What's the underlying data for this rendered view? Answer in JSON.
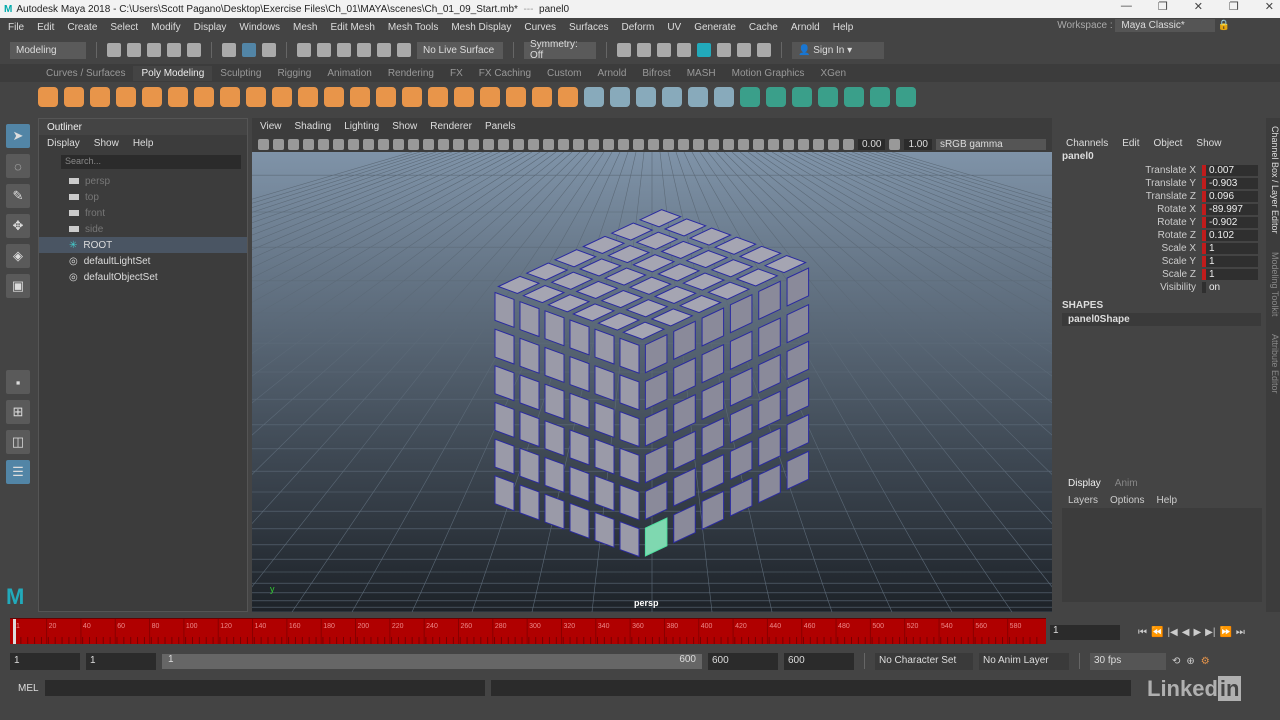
{
  "title": {
    "app": "Autodesk Maya 2018",
    "path": "C:\\Users\\Scott Pagano\\Desktop\\Exercise Files\\Ch_01\\MAYA\\scenes\\Ch_01_09_Start.mb*",
    "sep": "---",
    "panel": "panel0"
  },
  "menu": [
    "File",
    "Edit",
    "Create",
    "Select",
    "Modify",
    "Display",
    "Windows",
    "Mesh",
    "Edit Mesh",
    "Mesh Tools",
    "Mesh Display",
    "Curves",
    "Surfaces",
    "Deform",
    "UV",
    "Generate",
    "Cache",
    "Arnold",
    "Help"
  ],
  "workspace": {
    "label": "Workspace :",
    "value": "Maya Classic*"
  },
  "status": {
    "mode": "Modeling",
    "live_surface": "No Live Surface",
    "symmetry": "Symmetry: Off",
    "sign_in": "Sign In"
  },
  "shelf_tabs": [
    "Curves / Surfaces",
    "Poly Modeling",
    "Sculpting",
    "Rigging",
    "Animation",
    "Rendering",
    "FX",
    "FX Caching",
    "Custom",
    "Arnold",
    "Bifrost",
    "MASH",
    "Motion Graphics",
    "XGen"
  ],
  "shelf_active": 1,
  "outliner": {
    "title": "Outliner",
    "menu": [
      "Display",
      "Show",
      "Help"
    ],
    "search_placeholder": "Search...",
    "items": [
      {
        "label": "persp",
        "type": "camera",
        "dim": true
      },
      {
        "label": "top",
        "type": "camera",
        "dim": true
      },
      {
        "label": "front",
        "type": "camera",
        "dim": true
      },
      {
        "label": "side",
        "type": "camera",
        "dim": true
      },
      {
        "label": "ROOT",
        "type": "transform",
        "selected": true
      },
      {
        "label": "defaultLightSet",
        "type": "set"
      },
      {
        "label": "defaultObjectSet",
        "type": "set"
      }
    ]
  },
  "viewport": {
    "menu": [
      "View",
      "Shading",
      "Lighting",
      "Show",
      "Renderer",
      "Panels"
    ],
    "exposure": "0.00",
    "gamma": "1.00",
    "color_space": "sRGB gamma",
    "camera": "persp"
  },
  "channel_box": {
    "menu": [
      "Channels",
      "Edit",
      "Object",
      "Show"
    ],
    "object": "panel0",
    "attrs": [
      {
        "name": "Translate X",
        "value": "0.007"
      },
      {
        "name": "Translate Y",
        "value": "-0.903"
      },
      {
        "name": "Translate Z",
        "value": "0.096"
      },
      {
        "name": "Rotate X",
        "value": "-89.997"
      },
      {
        "name": "Rotate Y",
        "value": "-0.902"
      },
      {
        "name": "Rotate Z",
        "value": "0.102"
      },
      {
        "name": "Scale X",
        "value": "1"
      },
      {
        "name": "Scale Y",
        "value": "1"
      },
      {
        "name": "Scale Z",
        "value": "1"
      },
      {
        "name": "Visibility",
        "value": "on"
      }
    ],
    "shapes_label": "SHAPES",
    "shape": "panel0Shape"
  },
  "layer_editor": {
    "tabs": [
      "Display",
      "Anim"
    ],
    "menu": [
      "Layers",
      "Options",
      "Help"
    ]
  },
  "side_tabs": [
    "Channel Box / Layer Editor",
    "Modeling Toolkit",
    "Attribute Editor"
  ],
  "timeline": {
    "start": 1,
    "end": 600,
    "tick_step": 20,
    "current_frame": "1"
  },
  "range": {
    "start": "1",
    "playback_start": "1",
    "slider_start": "1",
    "slider_end": "600",
    "playback_end": "600",
    "end": "600",
    "character_set": "No Character Set",
    "anim_layer": "No Anim Layer",
    "fps": "30 fps"
  },
  "command": {
    "label": "MEL"
  },
  "watermark": "LinkedIn",
  "colors": {
    "accent": "#5285a6",
    "timeline": "#b00000",
    "keyed": "#c01c1c"
  }
}
